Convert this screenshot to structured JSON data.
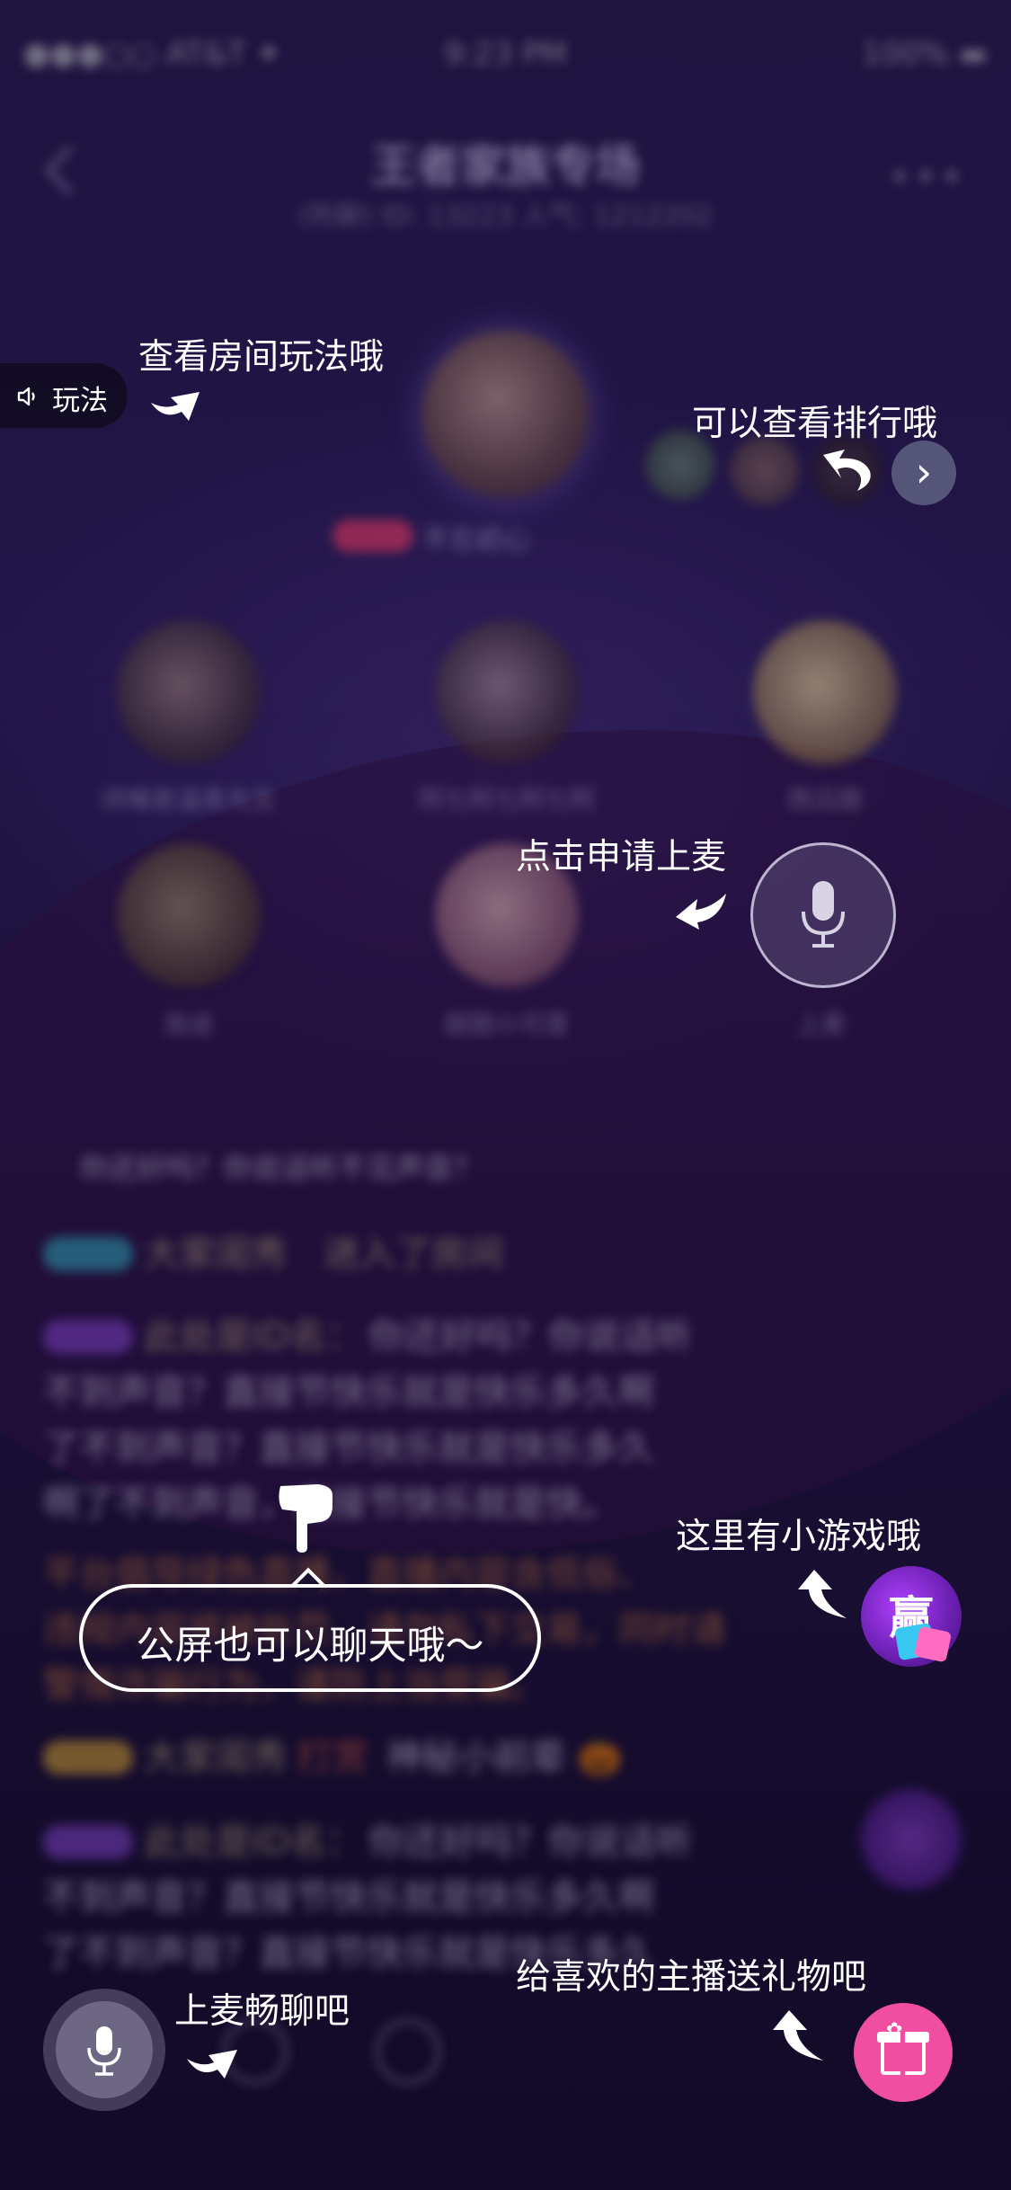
{
  "status_bar": {
    "carrier": "●●●○○ AT&T ✦",
    "time": "9:23 PM",
    "battery": "100% ▬"
  },
  "header": {
    "title": "王者家族专场",
    "subtitle": "(热聊)  ID: 13223  人气: 1212202",
    "more": "•••"
  },
  "host": {
    "name": "不忘初心"
  },
  "seats": [
    {
      "name": "闭嘴是温柔先生"
    },
    {
      "name": "阿七阿七阿七阿"
    },
    {
      "name": "西瓜甜"
    },
    {
      "name": "旅途"
    },
    {
      "name": "甜甜小可爱"
    },
    {
      "name": "上麦"
    }
  ],
  "chat": {
    "system_notice": "你还好吗？你说话听不见声音？",
    "msg1_user": "大家闺秀",
    "msg1_text": "进入了房间",
    "msg2_user": "此处是ID名：",
    "msg2_lines": [
      "你还好吗？你说话听",
      "不到声音？直接节快乐就是快乐多久啊",
      "了不到声音？直接节快乐就是快乐多久",
      "啊了不到声音，直接节快乐就是快。"
    ],
    "notice_lines": [
      "平台倡导绿色直播，直播内容含低俗、",
      "违规内容将被处罚，请勿私下交易，同时请",
      "警惕诈骗行为，谨防上当受骗。"
    ],
    "msg3_user": "大家闺秀",
    "msg3_gift": "打赏",
    "msg3_text": "神秘小前辈 🎃",
    "msg4_user": "此处是ID名：",
    "msg4_lines": [
      "你还好吗？你说话听",
      "不到声音？直接节快乐就是快乐多久啊",
      "了不到声音？直接节快乐就是快乐多久"
    ]
  },
  "guide": {
    "play_button": "玩法",
    "tip_play": "查看房间玩法哦",
    "tip_rank": "可以查看排行哦",
    "tip_apply_mic": "点击申请上麦",
    "tip_public_chat": "公屏也可以聊天哦～",
    "tip_game": "这里有小游戏哦",
    "game_icon_label": "赢",
    "tip_mic_chat": "上麦畅聊吧",
    "tip_gift": "给喜欢的主播送礼物吧"
  },
  "colors": {
    "accent_pink": "#f04ea0",
    "bubble_border": "#ffffff",
    "overlay": "#140a2a"
  }
}
